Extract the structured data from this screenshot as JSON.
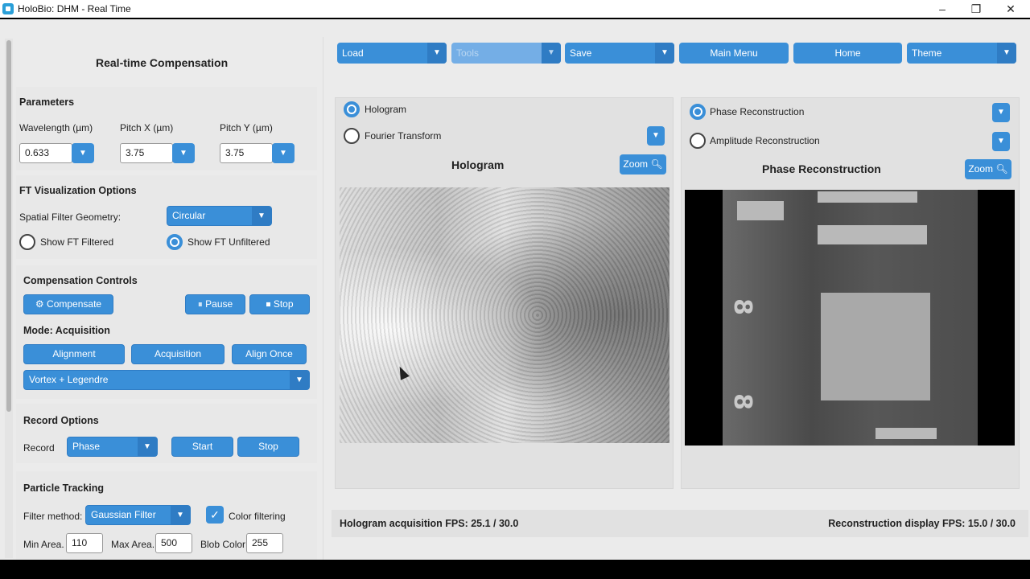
{
  "window": {
    "title": "HoloBio: DHM - Real Time",
    "minimize": "–",
    "maximize": "❐",
    "close": "✕"
  },
  "left": {
    "header": "Real-time Compensation",
    "parameters": {
      "title": "Parameters",
      "wavelength_label": "Wavelength (µm)",
      "wavelength_value": "0.633",
      "pitch_x_label": "Pitch X (µm)",
      "pitch_x_value": "3.75",
      "pitch_y_label": "Pitch Y (µm)",
      "pitch_y_value": "3.75"
    },
    "ft": {
      "title": "FT Visualization Options",
      "geometry_label": "Spatial Filter Geometry:",
      "geometry_value": "Circular",
      "show_filtered": "Show FT Filtered",
      "show_unfiltered": "Show FT Unfiltered",
      "selected": "Show FT Unfiltered"
    },
    "compensation": {
      "title": "Compensation Controls",
      "compensate": "Compensate",
      "pause": "Pause",
      "stop": "Stop",
      "mode": "Mode: Acquisition",
      "alignment": "Alignment",
      "acquisition": "Acquisition",
      "align_once": "Align Once",
      "method": "Vortex + Legendre"
    },
    "record": {
      "title": "Record Options",
      "record_label": "Record",
      "record_value": "Phase",
      "start": "Start",
      "stop": "Stop"
    },
    "particle": {
      "title": "Particle Tracking",
      "filter_label": "Filter method:",
      "filter_value": "Gaussian Filter",
      "color_filtering": "Color filtering",
      "color_filtering_checked": true,
      "min_area_label": "Min Area.",
      "min_area_value": "110",
      "max_area_label": "Max Area.",
      "max_area_value": "500",
      "blob_color_label": "Blob Color",
      "blob_color_value": "255"
    }
  },
  "toolbar": {
    "load": "Load",
    "tools": "Tools",
    "save": "Save",
    "main_menu": "Main Menu",
    "home": "Home",
    "theme": "Theme"
  },
  "hologram_panel": {
    "option_hologram": "Hologram",
    "option_ft": "Fourier Transform",
    "selected": "Hologram",
    "title": "Hologram",
    "zoom": "Zoom"
  },
  "phase_panel": {
    "option_phase": "Phase Reconstruction",
    "option_amplitude": "Amplitude Reconstruction",
    "selected": "Phase Reconstruction",
    "title": "Phase Reconstruction",
    "zoom": "Zoom",
    "digits": [
      "8",
      "8"
    ]
  },
  "status": {
    "hologram_fps": "Hologram acquisition FPS: 25.1 / 30.0",
    "reconstruction_fps": "Reconstruction display FPS: 15.0 / 30.0"
  },
  "colors": {
    "accent": "#3a8fd8",
    "accent_dark": "#2f7cc4",
    "panel_bg": "#e1e1e1",
    "window_bg": "#ebebeb"
  },
  "icons": {
    "compensate": "gear-icon",
    "pause": "pause-icon",
    "stop": "stop-icon",
    "zoom": "magnifier-icon",
    "dropdown": "chevron-down-icon"
  }
}
